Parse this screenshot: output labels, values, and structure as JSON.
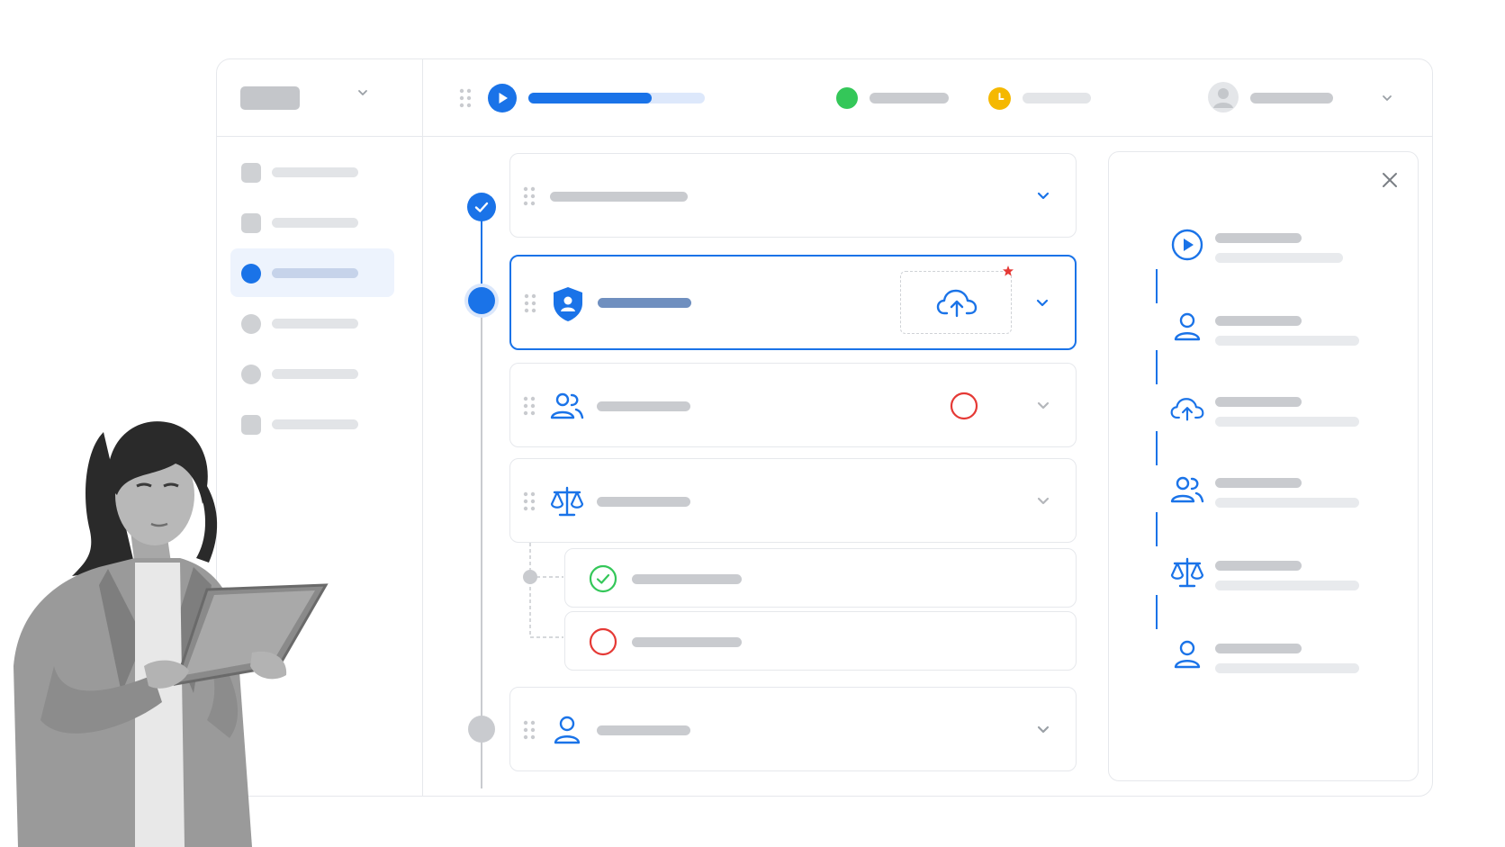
{
  "colors": {
    "accent": "#1a73e8",
    "success": "#34c759",
    "warning": "#f5b800",
    "error": "#e53935",
    "placeholder": "#c9cbcf"
  },
  "topbar": {
    "progress": 0.7,
    "status_online_icon": "green-dot-icon",
    "status_pending_icon": "clock-icon"
  },
  "sidebar": {
    "items": [
      {
        "icon": "square-icon",
        "active": false
      },
      {
        "icon": "square-icon",
        "active": false
      },
      {
        "icon": "dot-icon",
        "active": true
      },
      {
        "icon": "dot-icon",
        "active": false
      },
      {
        "icon": "dot-icon",
        "active": false
      },
      {
        "icon": "square-icon",
        "active": false
      }
    ]
  },
  "steps": [
    {
      "icon": "check-circle-icon",
      "state": "done"
    },
    {
      "icon": "shield-user-icon",
      "state": "active",
      "attachment": "upload-cloud-icon",
      "required": true
    },
    {
      "icon": "users-icon",
      "state": "pending",
      "status": "error-ring-icon"
    },
    {
      "icon": "scale-icon",
      "state": "pending",
      "children": [
        {
          "icon": "check-circle-icon",
          "state": "ok"
        },
        {
          "icon": "error-ring-icon",
          "state": "failed"
        }
      ]
    },
    {
      "icon": "user-icon",
      "state": "upcoming"
    }
  ],
  "panel": {
    "items": [
      "play-icon",
      "user-icon",
      "upload-cloud-icon",
      "users-icon",
      "scale-icon",
      "user-icon"
    ]
  }
}
